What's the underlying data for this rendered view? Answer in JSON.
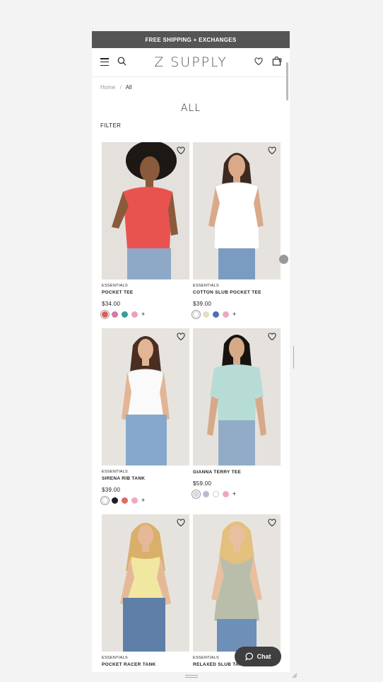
{
  "announcement": "FREE SHIPPING + EXCHANGES",
  "header": {
    "logo": "Z SUPPLY",
    "bag_count": "0"
  },
  "breadcrumb": {
    "home": "Home",
    "separator": "/",
    "current": "All"
  },
  "page_title": "ALL",
  "filter_label": "FILTER",
  "products": [
    {
      "category": "ESSENTIALS",
      "name": "POCKET TEE",
      "price": "$34.00",
      "swatches": [
        "#e05a55",
        "#d17b9f",
        "#3f9a98",
        "#e8a4b3"
      ],
      "more": "+"
    },
    {
      "category": "ESSENTIALS",
      "name": "COTTON SLUB POCKET TEE",
      "price": "$39.00",
      "swatches": [
        "#ffffff",
        "#e8dcc0",
        "#4f6fb6",
        "#eeaab8"
      ],
      "more": "+"
    },
    {
      "category": "ESSENTIALS",
      "name": "SIRENA RIB TANK",
      "price": "$39.00",
      "swatches": [
        "#ffffff",
        "#1d1d24",
        "#e06a6a",
        "#eeaab8"
      ],
      "more": "+"
    },
    {
      "category": "",
      "name": "GIANNA TERRY TEE",
      "price": "$59.00",
      "swatches": [
        "#d9dbe0",
        "#b8bad8",
        "#ffffff",
        "#eeaab8"
      ],
      "more": "+"
    },
    {
      "category": "ESSENTIALS",
      "name": "POCKET RACER TANK",
      "price": "",
      "swatches": [],
      "more": ""
    },
    {
      "category": "ESSENTIALS",
      "name": "RELAXED SLUB TANK",
      "price": "",
      "swatches": [],
      "more": ""
    }
  ],
  "chat_label": "Chat",
  "icons": {
    "menu": "menu-icon",
    "search": "search-icon",
    "wishlist": "heart-icon",
    "bag": "bag-icon",
    "chat": "chat-bubble-icon"
  }
}
